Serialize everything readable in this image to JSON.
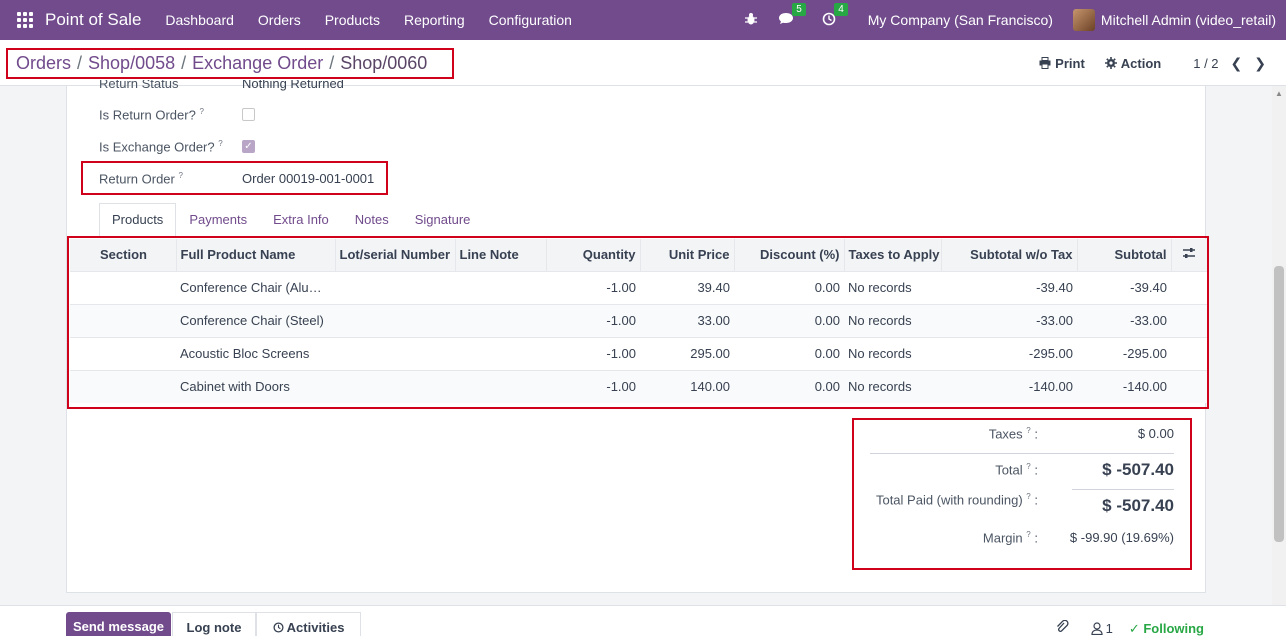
{
  "navbar": {
    "app_name": "Point of Sale",
    "menu": [
      "Dashboard",
      "Orders",
      "Products",
      "Reporting",
      "Configuration"
    ],
    "messages_count": "5",
    "activities_count": "4",
    "company": "My Company (San Francisco)",
    "user": "Mitchell Admin (video_retail)"
  },
  "breadcrumb": {
    "items": [
      "Orders",
      "Shop/0058",
      "Exchange Order"
    ],
    "current": "Shop/0060",
    "separator": "/"
  },
  "control": {
    "print_label": "Print",
    "action_label": "Action",
    "pager": "1 / 2"
  },
  "form": {
    "return_status_label": "Return Status",
    "return_status_value": "Nothing Returned",
    "is_return_label": "Is Return Order?",
    "is_return_checked": false,
    "is_exchange_label": "Is Exchange Order?",
    "is_exchange_checked": true,
    "return_order_label": "Return Order",
    "return_order_value": "Order 00019-001-0001",
    "help_mark": "?"
  },
  "tabs": [
    "Products",
    "Payments",
    "Extra Info",
    "Notes",
    "Signature"
  ],
  "table": {
    "headers": [
      "Section",
      "Full Product Name",
      "Lot/serial Number",
      "Line Note",
      "Quantity",
      "Unit Price",
      "Discount (%)",
      "Taxes to Apply",
      "Subtotal w/o Tax",
      "Subtotal"
    ],
    "rows": [
      {
        "product": "Conference Chair (Aluminium)",
        "qty": "-1.00",
        "price": "39.40",
        "discount": "0.00",
        "taxes": "No records",
        "subtotal_wo": "-39.40",
        "subtotal": "-39.40"
      },
      {
        "product": "Conference Chair (Steel)",
        "qty": "-1.00",
        "price": "33.00",
        "discount": "0.00",
        "taxes": "No records",
        "subtotal_wo": "-33.00",
        "subtotal": "-33.00"
      },
      {
        "product": "Acoustic Bloc Screens",
        "qty": "-1.00",
        "price": "295.00",
        "discount": "0.00",
        "taxes": "No records",
        "subtotal_wo": "-295.00",
        "subtotal": "-295.00"
      },
      {
        "product": "Cabinet with Doors",
        "qty": "-1.00",
        "price": "140.00",
        "discount": "0.00",
        "taxes": "No records",
        "subtotal_wo": "-140.00",
        "subtotal": "-140.00"
      }
    ]
  },
  "totals": {
    "taxes_label": "Taxes",
    "taxes_value": "$ 0.00",
    "total_label": "Total",
    "total_value": "$ -507.40",
    "paid_label": "Total Paid (with rounding)",
    "paid_value": "$ -507.40",
    "margin_label": "Margin",
    "margin_value": "$ -99.90 (19.69%)",
    "colon": ":"
  },
  "chatter": {
    "send_message": "Send message",
    "log_note": "Log note",
    "activities": "Activities",
    "followers_count": "1",
    "following": "Following"
  },
  "colors": {
    "brand": "#714b8c",
    "highlight": "#d0021b",
    "following": "#28a745"
  }
}
